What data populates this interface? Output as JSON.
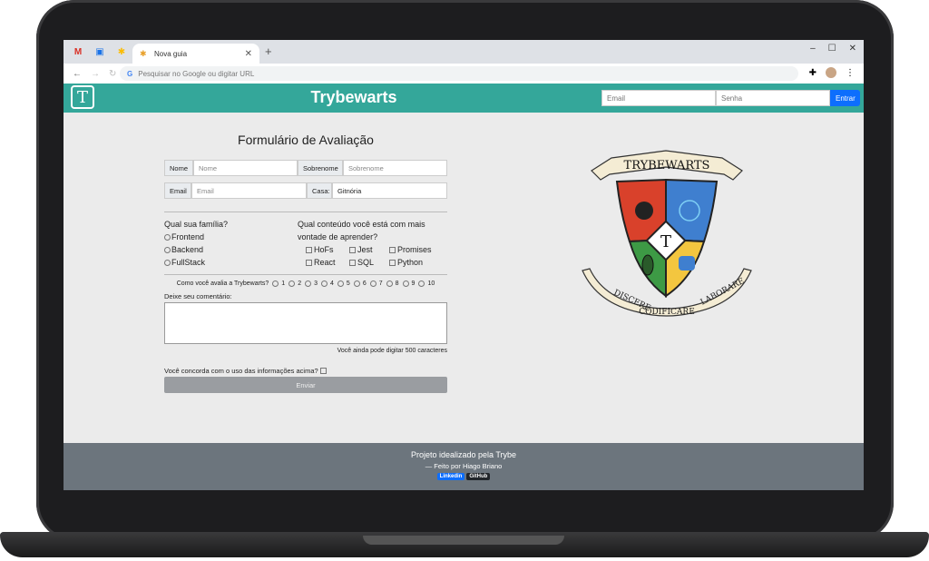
{
  "browser": {
    "tab_title": "Nova guia",
    "new_tab": "+",
    "omnibox_placeholder": "Pesquisar no Google ou digitar URL",
    "window_controls": [
      "–",
      "☐",
      "✕"
    ]
  },
  "header": {
    "logo_letter": "T",
    "title": "Trybewarts",
    "email_placeholder": "Email",
    "password_placeholder": "Senha",
    "login_button": "Entrar"
  },
  "form": {
    "title": "Formulário de Avaliação",
    "name_label": "Nome",
    "name_placeholder": "Nome",
    "lastname_label": "Sobrenome",
    "lastname_placeholder": "Sobrenome",
    "email_label": "Email",
    "email_placeholder": "Email",
    "house_label": "Casa:",
    "house_value": "Gitnória",
    "family_question": "Qual sua família?",
    "families": [
      "Frontend",
      "Backend",
      "FullStack"
    ],
    "content_question": "Qual conteúdo você está com mais vontade de aprender?",
    "contents": [
      "HoFs",
      "Jest",
      "Promises",
      "React",
      "SQL",
      "Python"
    ],
    "rating_question": "Como você avalia a Trybewarts?",
    "rating_options": [
      "1",
      "2",
      "3",
      "4",
      "5",
      "6",
      "7",
      "8",
      "9",
      "10"
    ],
    "comment_label": "Deixe seu comentário:",
    "counter_text": "Você ainda pode digitar 500 caracteres",
    "agreement_label": "Você concorda com o uso das informações acima?",
    "submit_label": "Enviar"
  },
  "crest": {
    "banner_top": "TRYBEWARTS",
    "center_letter": "T",
    "motto": [
      "DISCERE",
      "CODIFICARE",
      "LABORARE"
    ],
    "colors": {
      "red": "#d9412b",
      "blue": "#3f7fcf",
      "green": "#3d9a45",
      "yellow": "#f3c63f",
      "parchment": "#f4ecd4"
    }
  },
  "footer": {
    "line1": "Projeto idealizado pela Trybe",
    "line2": "— Feito por Hiago Briano",
    "linkedin": "Linkedin",
    "github": "GitHub"
  }
}
